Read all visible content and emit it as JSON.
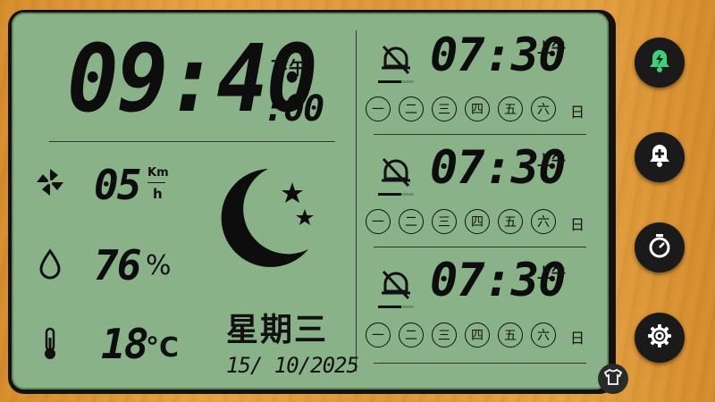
{
  "clock": {
    "time": "09:40",
    "seconds": ":00",
    "ampm": "下午"
  },
  "sensors": {
    "wind": {
      "icon": "pinwheel-icon",
      "value": "05",
      "unit_top": "Km",
      "unit_bottom": "h"
    },
    "humidity": {
      "icon": "water-drop-icon",
      "value": "76",
      "unit": "%"
    },
    "temperature": {
      "icon": "thermometer-icon",
      "value": "18",
      "unit": "°C"
    }
  },
  "weather": {
    "icon": "moon-stars-icon"
  },
  "weekday": "星期三",
  "date": "15/ 10/2025",
  "alarms": [
    {
      "time": "07:30",
      "ampm": "上午",
      "icon": "alarm-off-icon",
      "days": [
        "一",
        "二",
        "三",
        "四",
        "五",
        "六"
      ],
      "sunday": "日"
    },
    {
      "time": "07:30",
      "ampm": "上午",
      "icon": "alarm-off-icon",
      "days": [
        "一",
        "二",
        "三",
        "四",
        "五",
        "六"
      ],
      "sunday": "日"
    },
    {
      "time": "07:30",
      "ampm": "上午",
      "icon": "alarm-off-icon",
      "days": [
        "一",
        "二",
        "三",
        "四",
        "五",
        "六"
      ],
      "sunday": "日"
    }
  ],
  "side_buttons": [
    {
      "name": "alarm-sound-button",
      "icon": "bell-bolt-icon",
      "accent": "#3fcf7a"
    },
    {
      "name": "add-alarm-button",
      "icon": "bell-plus-icon",
      "accent": "#ffffff"
    },
    {
      "name": "timer-button",
      "icon": "stopwatch-icon",
      "accent": "#ffffff"
    },
    {
      "name": "settings-button",
      "icon": "gear-icon",
      "accent": "#ffffff"
    }
  ],
  "theme_button": {
    "icon": "shirt-icon"
  },
  "colors": {
    "lcd_bg": "#89b289",
    "wood": "#e0a040",
    "segment": "#0d0d0d"
  }
}
